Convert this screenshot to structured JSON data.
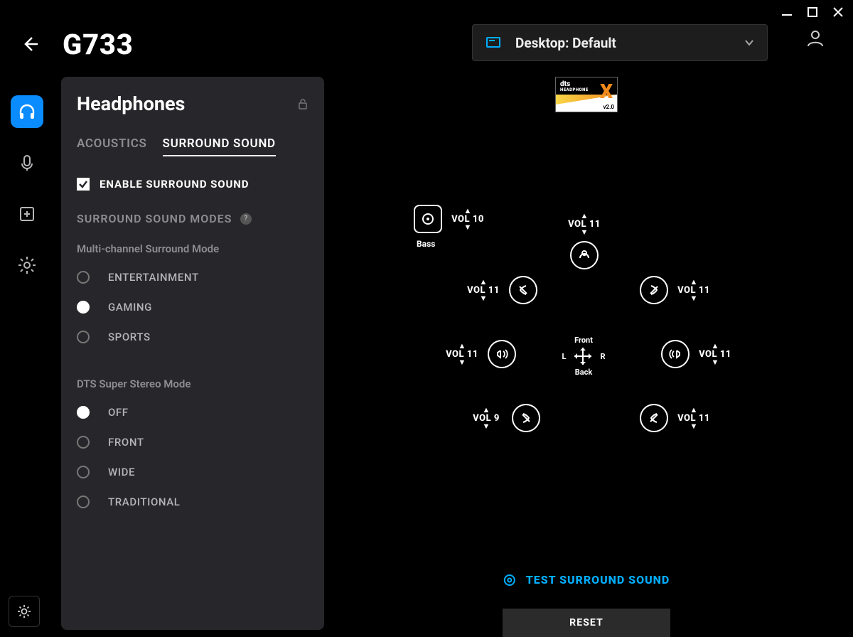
{
  "device_name": "G733",
  "profile_label": "Desktop: Default",
  "panel_title": "Headphones",
  "tabs": {
    "acoustics": "ACOUSTICS",
    "surround": "SURROUND SOUND"
  },
  "enable_label": "ENABLE SURROUND SOUND",
  "modes_title": "SURROUND SOUND MODES",
  "multi_title": "Multi-channel Surround Mode",
  "multi_options": {
    "entertainment": "ENTERTAINMENT",
    "gaming": "GAMING",
    "sports": "SPORTS"
  },
  "dts_title": "DTS Super Stereo Mode",
  "dts_options": {
    "off": "OFF",
    "front": "FRONT",
    "wide": "WIDE",
    "traditional": "TRADITIONAL"
  },
  "badge": {
    "brand": "dts",
    "sub": "HEADPHONE",
    "ver": "v2.0"
  },
  "speakers": {
    "bass": {
      "vol": "VOL 10",
      "label": "Bass"
    },
    "center": {
      "vol": "VOL 11"
    },
    "fl": {
      "vol": "VOL 11"
    },
    "fr": {
      "vol": "VOL 11"
    },
    "sl": {
      "vol": "VOL 11"
    },
    "sr": {
      "vol": "VOL 11"
    },
    "rl": {
      "vol": "VOL 9"
    },
    "rr": {
      "vol": "VOL 11"
    }
  },
  "compass": {
    "front": "Front",
    "back": "Back",
    "l": "L",
    "r": "R"
  },
  "test_label": "TEST SURROUND SOUND",
  "reset_label": "RESET"
}
